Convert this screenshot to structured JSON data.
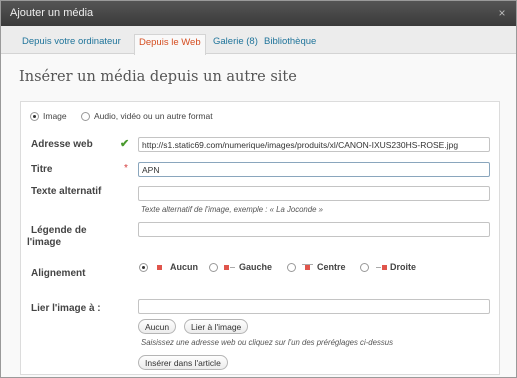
{
  "dialog": {
    "title": "Ajouter un média",
    "close": "×"
  },
  "tabs": [
    {
      "label": "Depuis votre ordinateur",
      "active": false
    },
    {
      "label": "Depuis le Web",
      "active": true
    },
    {
      "label": "Galerie (8)",
      "active": false
    },
    {
      "label": "Bibliothèque",
      "active": false
    }
  ],
  "heading": "Insérer un média depuis un autre site",
  "media_type": {
    "options": [
      "Image",
      "Audio, vidéo ou un autre format"
    ],
    "selected": "Image"
  },
  "form": {
    "url": {
      "label": "Adresse web",
      "value": "http://s1.static69.com/numerique/images/produits/xl/CANON-IXUS230HS-ROSE.jpg"
    },
    "title": {
      "label": "Titre",
      "value": "APN",
      "required_mark": "*"
    },
    "alt": {
      "label": "Texte alternatif",
      "value": "",
      "hint": "Texte alternatif de l'image, exemple : « La Joconde »"
    },
    "caption": {
      "label_line1": "Légende de",
      "label_line2": "l'image",
      "value": ""
    },
    "alignment": {
      "label": "Alignement",
      "selected": "Aucun",
      "options": [
        "Aucun",
        "Gauche",
        "Centre",
        "Droite"
      ]
    },
    "link": {
      "label": "Lier l'image à :",
      "value": "",
      "buttons": {
        "none": "Aucun",
        "image": "Lier à l'image"
      },
      "hint": "Saisissez une adresse web ou cliquez sur l'un des préréglages ci-dessus"
    },
    "submit_label": "Insérer dans l'article"
  },
  "colors": {
    "link": "#21759b",
    "active_tab": "#d54e21",
    "valid_check": "#4a9a2e",
    "align_icon": "#e0554c"
  },
  "icons": {
    "url_valid": "checkmark-icon",
    "close": "close-icon"
  }
}
